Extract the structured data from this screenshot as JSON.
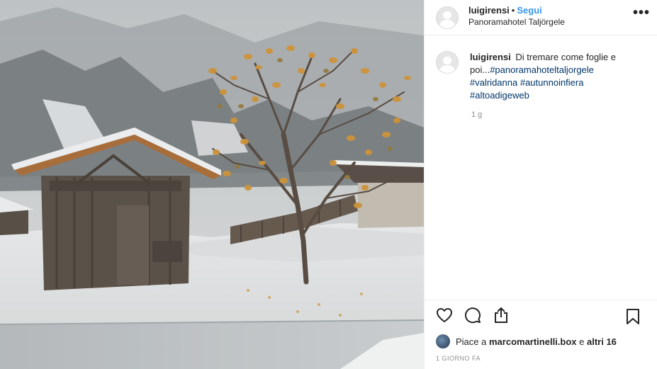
{
  "header": {
    "username": "luigirensi",
    "separator": "•",
    "follow_label": "Segui",
    "location": "Panoramahotel Taljörgele",
    "more_label": "•••"
  },
  "caption": {
    "username": "luigirensi",
    "text": "Di tremare come foglie e poi...",
    "hashtags": [
      "#panoramahoteltaljorgele",
      "#valridanna",
      "#autunnoinfiera",
      "#altoadigeweb"
    ],
    "time": "1 g"
  },
  "likes": {
    "prefix": "Piace a ",
    "user": "marcomartinelli.box",
    "middle": " e ",
    "others": "altri 16"
  },
  "timestamp": "1 GIORNO FA",
  "icons": {
    "like": "heart-icon",
    "comment": "comment-icon",
    "share": "share-icon",
    "save": "bookmark-icon"
  },
  "colors": {
    "link_blue": "#3897f0",
    "hashtag": "#003569",
    "muted": "#8e8e8e"
  }
}
